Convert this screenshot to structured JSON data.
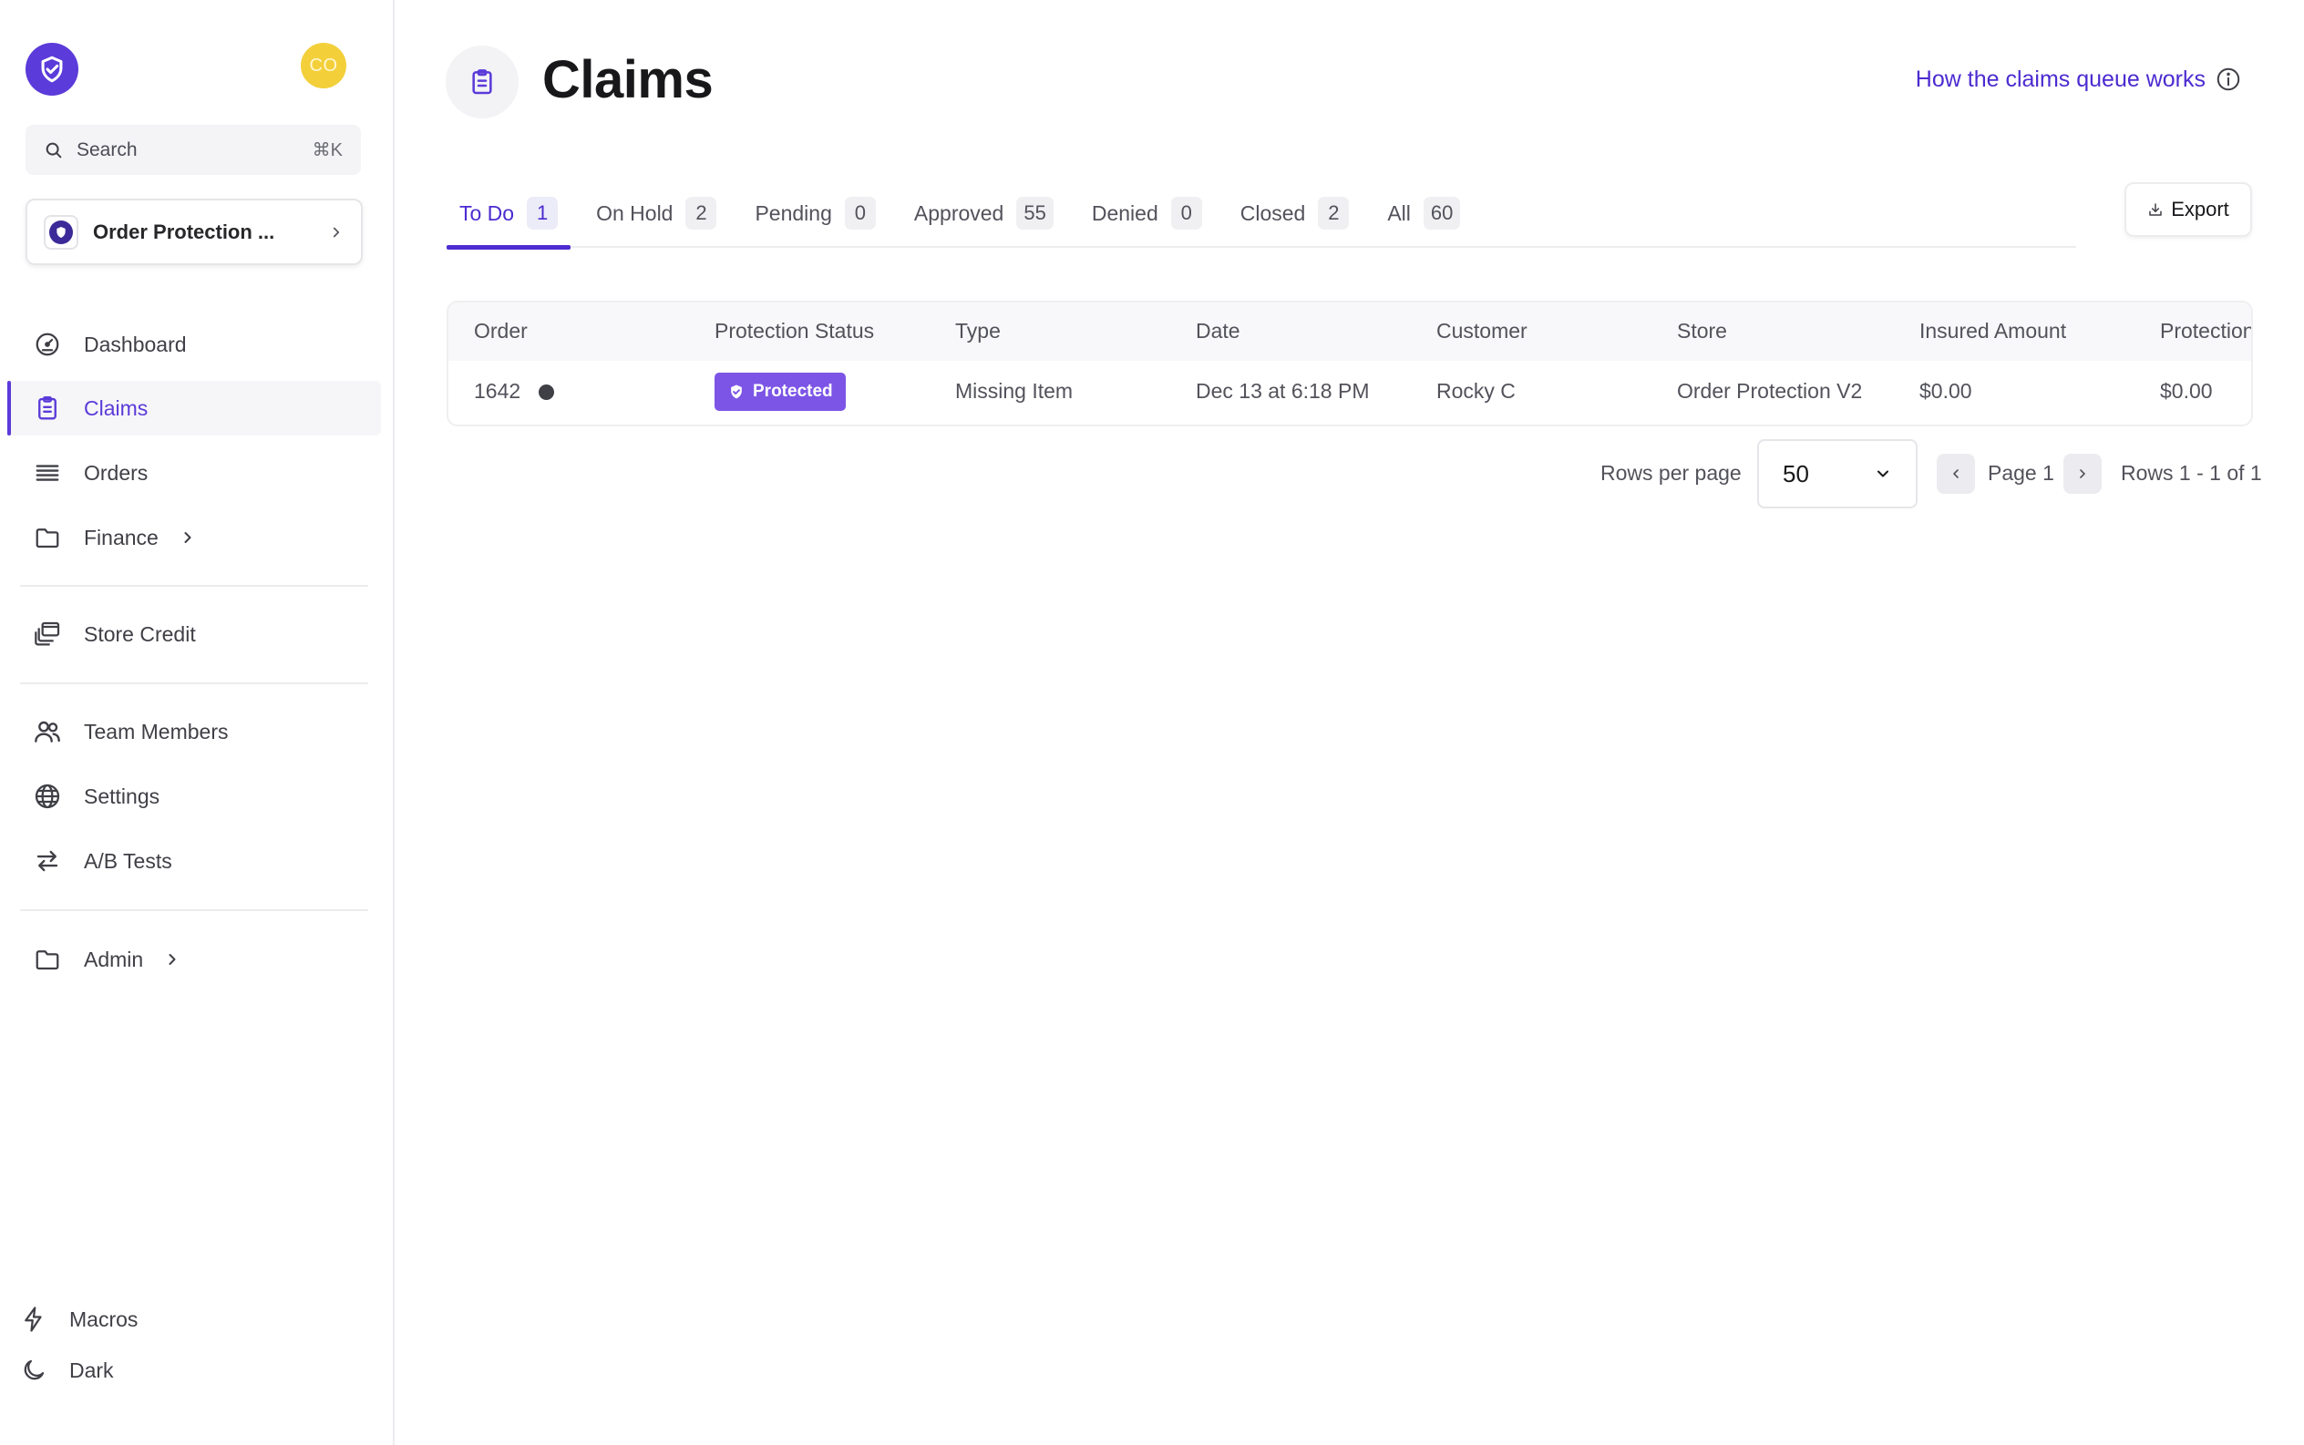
{
  "sidebar": {
    "avatar_initials": "CO",
    "search": {
      "label": "Search",
      "shortcut": "⌘K"
    },
    "store_switcher": {
      "name": "Order Protection ..."
    },
    "nav": [
      {
        "label": "Dashboard",
        "icon": "dashboard-gauge-icon"
      },
      {
        "label": "Claims",
        "icon": "clipboard-icon",
        "active": true
      },
      {
        "label": "Orders",
        "icon": "orders-stack-icon"
      },
      {
        "label": "Finance",
        "icon": "folder-icon",
        "has_children": true
      },
      {
        "label": "Store Credit",
        "icon": "store-credit-icon"
      },
      {
        "label": "Team Members",
        "icon": "users-icon"
      },
      {
        "label": "Settings",
        "icon": "globe-icon"
      },
      {
        "label": "A/B Tests",
        "icon": "arrows-swap-icon"
      },
      {
        "label": "Admin",
        "icon": "folder-icon",
        "has_children": true
      }
    ],
    "bottom": [
      {
        "label": "Macros",
        "icon": "lightning-icon"
      },
      {
        "label": "Dark",
        "icon": "moon-icon"
      }
    ]
  },
  "header": {
    "title": "Claims",
    "help_link": "How the claims queue works"
  },
  "tabs": [
    {
      "label": "To Do",
      "count": "1",
      "active": true
    },
    {
      "label": "On Hold",
      "count": "2"
    },
    {
      "label": "Pending",
      "count": "0"
    },
    {
      "label": "Approved",
      "count": "55"
    },
    {
      "label": "Denied",
      "count": "0"
    },
    {
      "label": "Closed",
      "count": "2"
    },
    {
      "label": "All",
      "count": "60"
    }
  ],
  "export_label": "Export",
  "table": {
    "columns": [
      "Order",
      "Protection Status",
      "Type",
      "Date",
      "Customer",
      "Store",
      "Insured Amount",
      "Protection"
    ],
    "rows": [
      {
        "order": "1642",
        "protection_status": "Protected",
        "type": "Missing Item",
        "date": "Dec 13 at 6:18 PM",
        "customer": "Rocky C",
        "store": "Order Protection V2",
        "insured_amount": "$0.00",
        "protection": "$0.00"
      }
    ]
  },
  "pagination": {
    "rows_per_page_label": "Rows per page",
    "rows_per_page_value": "50",
    "page_label": "Page 1",
    "rows_label": "Rows 1 - 1 of 1"
  },
  "colors": {
    "accent": "#5b3bd9",
    "link": "#4c2bd0",
    "badge_protected": "#7c55e6",
    "avatar": "#f3cf3a"
  }
}
